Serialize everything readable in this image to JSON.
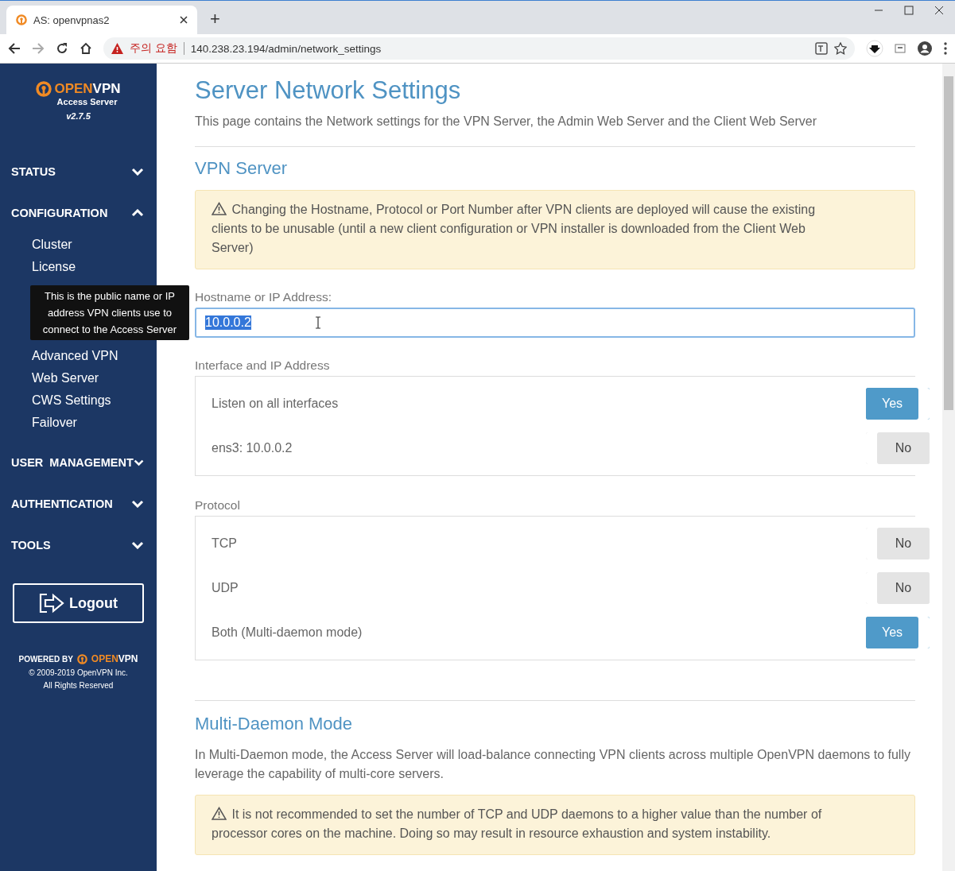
{
  "browser": {
    "tab_title": "AS: openvpnas2",
    "new_tab": "+",
    "address": {
      "warning": "주의 요함",
      "url": "140.238.23.194/admin/network_settings"
    }
  },
  "sidebar": {
    "logo": {
      "brand_open": "OPEN",
      "brand_vpn": "VPN",
      "product": "Access Server",
      "version": "v2.7.5"
    },
    "sections": [
      {
        "label": "STATUS",
        "expanded": false
      },
      {
        "label": "CONFIGURATION",
        "expanded": true,
        "children": [
          {
            "label": "Cluster"
          },
          {
            "label": "License"
          }
        ],
        "children_after_tooltip": [
          {
            "label": "Advanced VPN"
          },
          {
            "label": "Web Server"
          },
          {
            "label": "CWS Settings"
          },
          {
            "label": "Failover"
          }
        ]
      },
      {
        "label": "USER  MANAGEMENT",
        "expanded": false
      },
      {
        "label": "AUTHENTICATION",
        "expanded": false
      },
      {
        "label": "TOOLS",
        "expanded": false
      }
    ],
    "tooltip": "This is the public name or IP address VPN clients use to connect to the Access Server",
    "logout": "Logout",
    "footer": {
      "powered_by": "POWERED BY",
      "brand_open": "OPEN",
      "brand_vpn": "VPN",
      "copyright": "© 2009-2019 OpenVPN Inc.",
      "rights": "All Rights Reserved"
    }
  },
  "main": {
    "title": "Server Network Settings",
    "subtitle": "This page contains the Network settings for the VPN Server, the Admin Web Server and the Client Web Server",
    "vpn_server": {
      "heading": "VPN Server",
      "alert": "Changing the Hostname, Protocol or Port Number after VPN clients are deployed will cause the existing clients to be unusable (until a new client configuration or VPN installer is downloaded from the Client Web Server)",
      "hostname": {
        "label": "Hostname or IP Address:",
        "value": "10.0.0.2"
      },
      "groups": [
        {
          "label": "Interface and IP Address",
          "options": [
            {
              "label": "Listen on all interfaces",
              "on": true,
              "text": "Yes"
            },
            {
              "label": "ens3: 10.0.0.2",
              "on": false,
              "text": "No"
            }
          ]
        },
        {
          "label": "Protocol",
          "options": [
            {
              "label": "TCP",
              "on": false,
              "text": "No"
            },
            {
              "label": "UDP",
              "on": false,
              "text": "No"
            },
            {
              "label": "Both (Multi-daemon mode)",
              "on": true,
              "text": "Yes"
            }
          ]
        }
      ]
    },
    "multi_daemon": {
      "heading": "Multi-Daemon Mode",
      "text": "In Multi-Daemon mode, the Access Server will load-balance connecting VPN clients across multiple OpenVPN daemons to fully leverage the capability of multi-core servers.",
      "alert": "It is not recommended to set the number of TCP and UDP daemons to a higher value than the number of processor cores on the machine. Doing so may result in resource exhaustion and system instability."
    }
  }
}
